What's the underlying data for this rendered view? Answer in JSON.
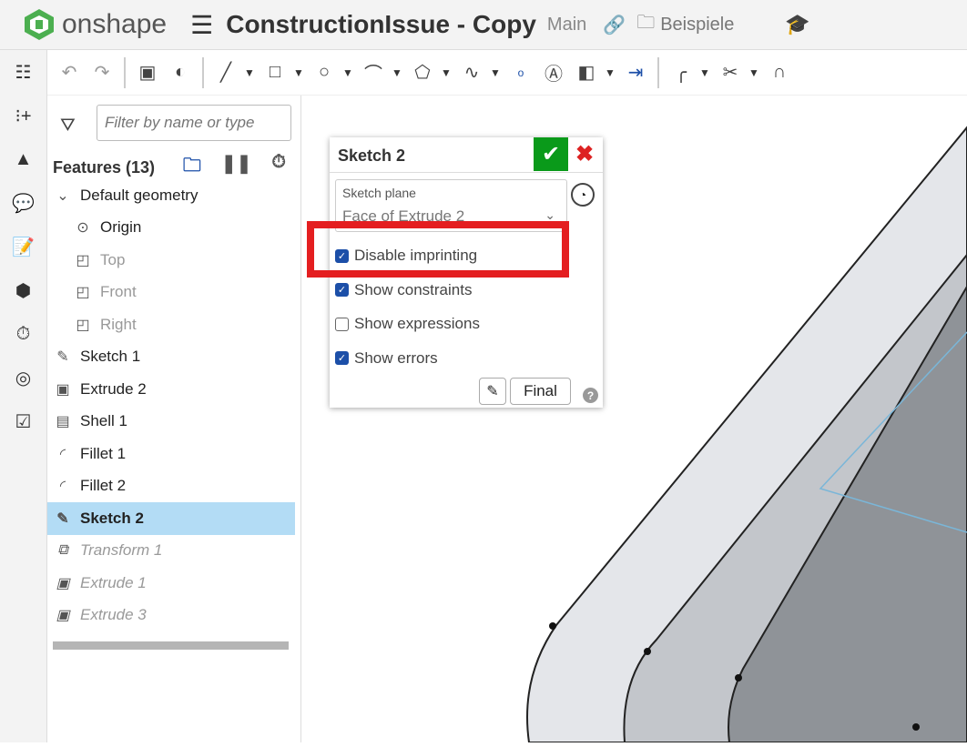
{
  "header": {
    "app": "onshape",
    "title": "ConstructionIssue - Copy",
    "branch": "Main",
    "folder": "Beispiele"
  },
  "feature_panel": {
    "filter_placeholder": "Filter by name or type",
    "header": "Features (13)",
    "items": [
      {
        "label": "Default geometry",
        "icon": "chevron-down-icon",
        "state": "normal"
      },
      {
        "label": "Origin",
        "icon": "origin-icon",
        "state": "normal"
      },
      {
        "label": "Top",
        "icon": "plane-icon",
        "state": "dim"
      },
      {
        "label": "Front",
        "icon": "plane-icon",
        "state": "dim"
      },
      {
        "label": "Right",
        "icon": "plane-icon",
        "state": "dim"
      },
      {
        "label": "Sketch 1",
        "icon": "sketch-icon",
        "state": "normal"
      },
      {
        "label": "Extrude 2",
        "icon": "extrude-icon",
        "state": "normal"
      },
      {
        "label": "Shell 1",
        "icon": "shell-icon",
        "state": "normal"
      },
      {
        "label": "Fillet 1",
        "icon": "fillet-icon",
        "state": "normal"
      },
      {
        "label": "Fillet 2",
        "icon": "fillet-icon",
        "state": "normal"
      },
      {
        "label": "Sketch 2",
        "icon": "sketch-icon",
        "state": "selected"
      },
      {
        "label": "Transform 1",
        "icon": "transform-icon",
        "state": "suppressed"
      },
      {
        "label": "Extrude 1",
        "icon": "extrude-icon",
        "state": "suppressed"
      },
      {
        "label": "Extrude 3",
        "icon": "extrude-icon",
        "state": "suppressed"
      }
    ]
  },
  "dialog": {
    "title": "Sketch 2",
    "plane_label": "Sketch plane",
    "plane_value": "Face of Extrude 2",
    "options": [
      {
        "label": "Disable imprinting",
        "checked": true
      },
      {
        "label": "Show constraints",
        "checked": true
      },
      {
        "label": "Show expressions",
        "checked": false
      },
      {
        "label": "Show errors",
        "checked": true
      }
    ],
    "final_label": "Final"
  },
  "colors": {
    "accent": "#1c4fa8",
    "ok": "#0a9a1a",
    "highlight": "#e41e20",
    "selected": "#b3dcf5"
  }
}
